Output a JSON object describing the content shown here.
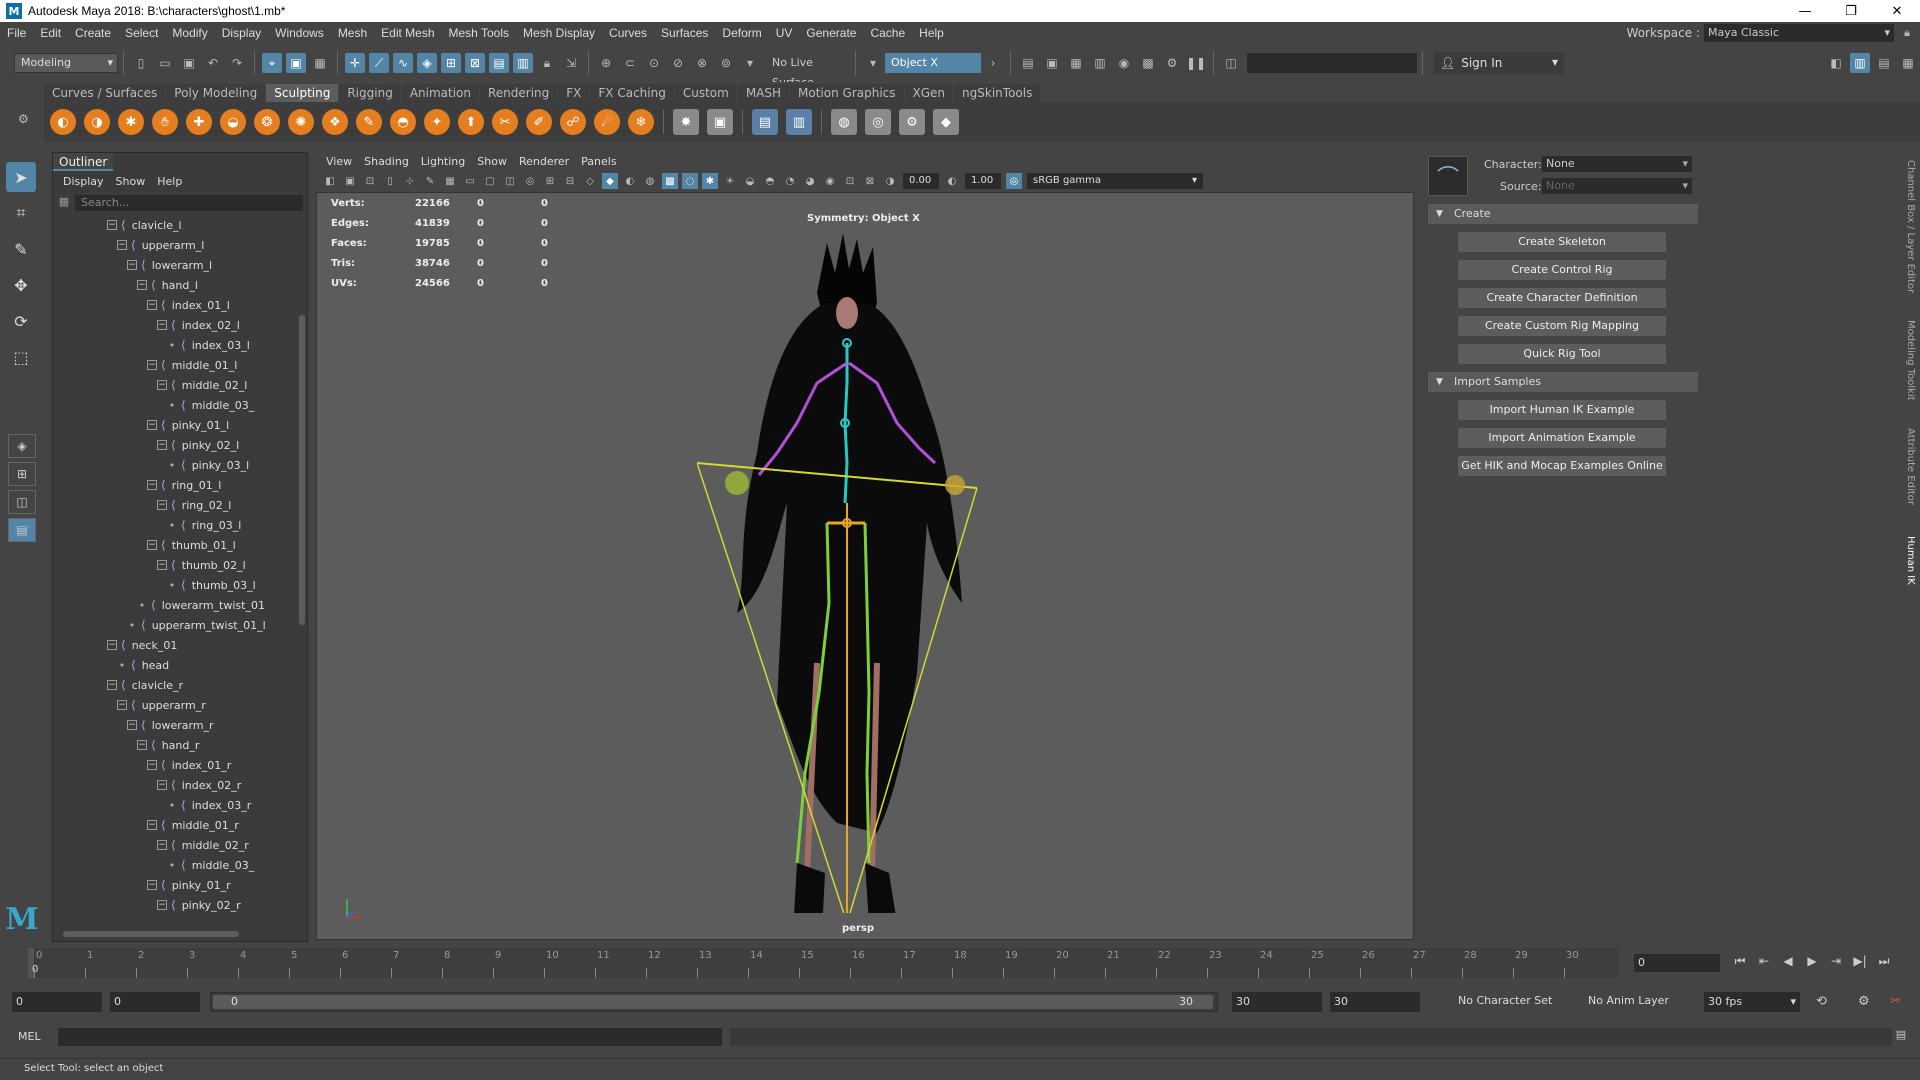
{
  "window": {
    "title": "Autodesk Maya 2018: B:\\characters\\ghost\\1.mb*",
    "logo": "M"
  },
  "menubar": {
    "items": [
      "File",
      "Edit",
      "Create",
      "Select",
      "Modify",
      "Display",
      "Windows",
      "Mesh",
      "Edit Mesh",
      "Mesh Tools",
      "Mesh Display",
      "Curves",
      "Surfaces",
      "Deform",
      "UV",
      "Generate",
      "Cache",
      "Help"
    ],
    "workspace_label": "Workspace :",
    "workspace_value": "Maya Classic"
  },
  "statusline": {
    "mode": "Modeling",
    "live_surface": "No Live Surface",
    "symmetry": "Object X",
    "sign_in": "Sign In"
  },
  "shelf": {
    "tabs": [
      "Curves / Surfaces",
      "Poly Modeling",
      "Sculpting",
      "Rigging",
      "Animation",
      "Rendering",
      "FX",
      "FX Caching",
      "Custom",
      "MASH",
      "Motion Graphics",
      "XGen",
      "ngSkinTools"
    ],
    "active_tab": "Sculpting"
  },
  "outliner": {
    "tab": "Outliner",
    "menu": [
      "Display",
      "Show",
      "Help"
    ],
    "search_placeholder": "Search...",
    "rows": [
      {
        "label": "clavicle_l",
        "indent": 4,
        "kind": "exp"
      },
      {
        "label": "upperarm_l",
        "indent": 5,
        "kind": "exp"
      },
      {
        "label": "lowerarm_l",
        "indent": 6,
        "kind": "exp"
      },
      {
        "label": "hand_l",
        "indent": 7,
        "kind": "exp"
      },
      {
        "label": "index_01_l",
        "indent": 8,
        "kind": "exp"
      },
      {
        "label": "index_02_l",
        "indent": 9,
        "kind": "exp"
      },
      {
        "label": "index_03_l",
        "indent": 10,
        "kind": "dot"
      },
      {
        "label": "middle_01_l",
        "indent": 8,
        "kind": "exp"
      },
      {
        "label": "middle_02_l",
        "indent": 9,
        "kind": "exp"
      },
      {
        "label": "middle_03_",
        "indent": 10,
        "kind": "dot"
      },
      {
        "label": "pinky_01_l",
        "indent": 8,
        "kind": "exp"
      },
      {
        "label": "pinky_02_l",
        "indent": 9,
        "kind": "exp"
      },
      {
        "label": "pinky_03_l",
        "indent": 10,
        "kind": "dot"
      },
      {
        "label": "ring_01_l",
        "indent": 8,
        "kind": "exp"
      },
      {
        "label": "ring_02_l",
        "indent": 9,
        "kind": "exp"
      },
      {
        "label": "ring_03_l",
        "indent": 10,
        "kind": "dot"
      },
      {
        "label": "thumb_01_l",
        "indent": 8,
        "kind": "exp"
      },
      {
        "label": "thumb_02_l",
        "indent": 9,
        "kind": "exp"
      },
      {
        "label": "thumb_03_l",
        "indent": 10,
        "kind": "dot"
      },
      {
        "label": "lowerarm_twist_01",
        "indent": 7,
        "kind": "dot"
      },
      {
        "label": "upperarm_twist_01_l",
        "indent": 6,
        "kind": "dot"
      },
      {
        "label": "neck_01",
        "indent": 4,
        "kind": "exp"
      },
      {
        "label": "head",
        "indent": 5,
        "kind": "dot"
      },
      {
        "label": "clavicle_r",
        "indent": 4,
        "kind": "exp"
      },
      {
        "label": "upperarm_r",
        "indent": 5,
        "kind": "exp"
      },
      {
        "label": "lowerarm_r",
        "indent": 6,
        "kind": "exp"
      },
      {
        "label": "hand_r",
        "indent": 7,
        "kind": "exp"
      },
      {
        "label": "index_01_r",
        "indent": 8,
        "kind": "exp"
      },
      {
        "label": "index_02_r",
        "indent": 9,
        "kind": "exp"
      },
      {
        "label": "index_03_r",
        "indent": 10,
        "kind": "dot"
      },
      {
        "label": "middle_01_r",
        "indent": 8,
        "kind": "exp"
      },
      {
        "label": "middle_02_r",
        "indent": 9,
        "kind": "exp"
      },
      {
        "label": "middle_03_",
        "indent": 10,
        "kind": "dot"
      },
      {
        "label": "pinky_01_r",
        "indent": 8,
        "kind": "exp"
      },
      {
        "label": "pinky_02_r",
        "indent": 9,
        "kind": "exp"
      }
    ]
  },
  "viewport": {
    "menu": [
      "View",
      "Shading",
      "Lighting",
      "Show",
      "Renderer",
      "Panels"
    ],
    "exposure": "0.00",
    "gamma": "1.00",
    "color_space": "sRGB gamma",
    "hud": [
      {
        "label": "Verts:",
        "v1": "22166",
        "v2": "0",
        "v3": "0"
      },
      {
        "label": "Edges:",
        "v1": "41839",
        "v2": "0",
        "v3": "0"
      },
      {
        "label": "Faces:",
        "v1": "19785",
        "v2": "0",
        "v3": "0"
      },
      {
        "label": "Tris:",
        "v1": "38746",
        "v2": "0",
        "v3": "0"
      },
      {
        "label": "UVs:",
        "v1": "24566",
        "v2": "0",
        "v3": "0"
      }
    ],
    "symmetry_label": "Symmetry: Object X",
    "camera": "persp"
  },
  "hik": {
    "character_label": "Character:",
    "character_value": "None",
    "source_label": "Source:",
    "source_value": "None",
    "create_section": "Create",
    "create_buttons": [
      "Create Skeleton",
      "Create Control Rig",
      "Create Character Definition",
      "Create Custom Rig Mapping",
      "Quick Rig Tool"
    ],
    "import_section": "Import Samples",
    "import_buttons": [
      "Import Human IK Example",
      "Import Animation Example",
      "Get HIK and Mocap Examples Online"
    ]
  },
  "side_tabs": [
    "Channel Box / Layer Editor",
    "Modeling Toolkit",
    "Attribute Editor",
    "Human IK"
  ],
  "timeline": {
    "start": 0,
    "end": 30,
    "current_frame": "0",
    "current_label": "0"
  },
  "range": {
    "start_field": "0",
    "anim_start": "0",
    "range_start": "0",
    "range_end": "30",
    "anim_end_field": "30",
    "end_field": "30",
    "character_set": "No Character Set",
    "anim_layer": "No Anim Layer",
    "fps": "30 fps"
  },
  "cmdline": {
    "lang": "MEL"
  },
  "helpline": {
    "text": "Select Tool: select an object"
  }
}
